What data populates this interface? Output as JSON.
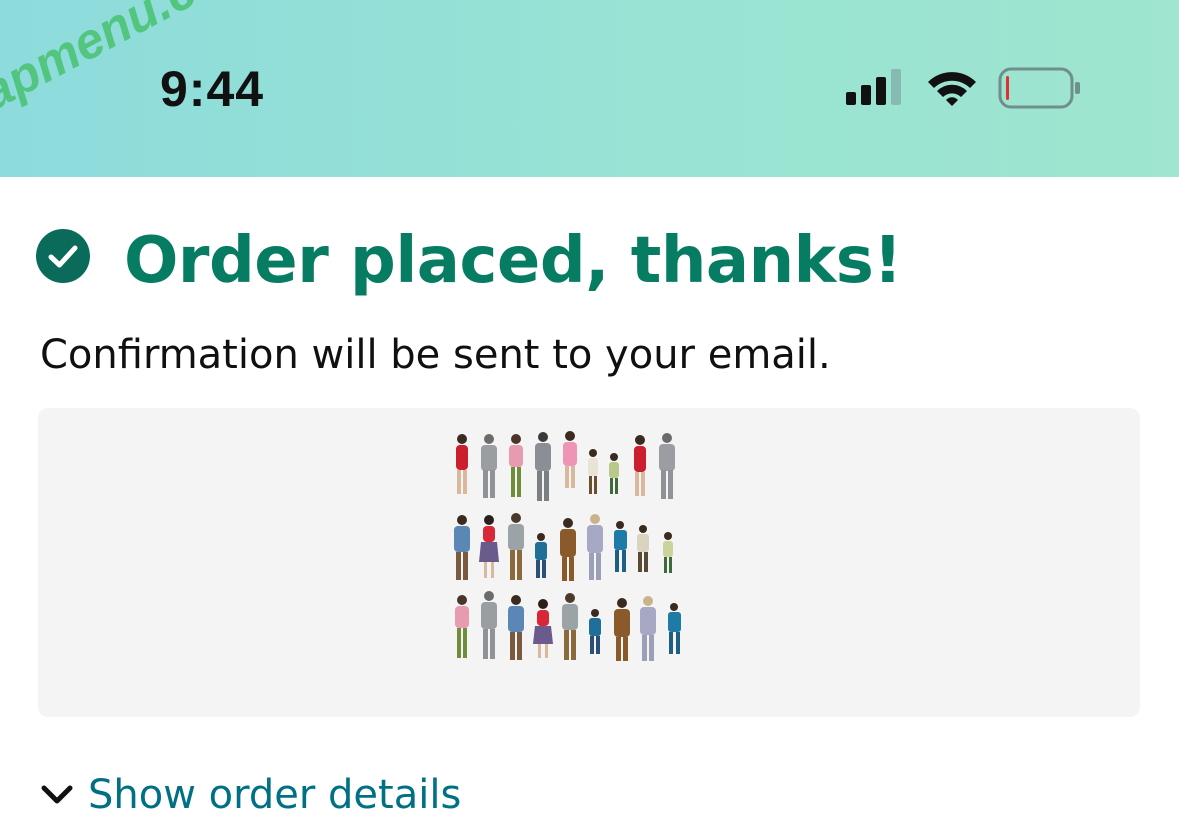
{
  "status_bar": {
    "time": "9:44",
    "watermark": "fapmenu.com",
    "signal_icon": "cellular-signal-icon",
    "wifi_icon": "wifi-icon",
    "battery_icon": "battery-low-icon",
    "battery_level": 0.05,
    "gradient_colors": [
      "#8ddbdc",
      "#9fe5cf"
    ]
  },
  "confirmation": {
    "icon": "check-circle-icon",
    "title": "Order placed, thanks!",
    "message": "Confirmation will be sent to your email.",
    "title_color": "#067d62"
  },
  "order": {
    "product_image": "miniature-people-figures-image",
    "details_toggle_icon": "chevron-down-icon",
    "details_label": "Show order details",
    "link_color": "#007185"
  }
}
